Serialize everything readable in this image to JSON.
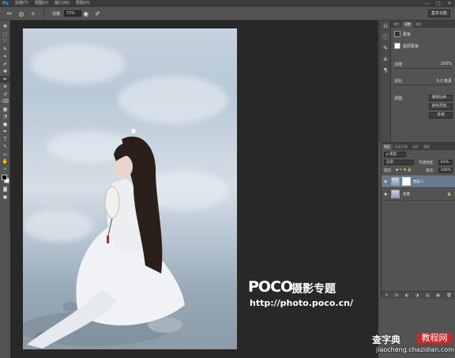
{
  "app": {
    "logo": "Ps"
  },
  "menubar": {
    "items": [
      "滤镜(T)",
      "视图(V)",
      "窗口(W)",
      "帮助(H)"
    ],
    "controls": [
      "—",
      "□",
      "✕"
    ]
  },
  "options": {
    "opacity_label": "流量:",
    "opacity_value": "72%",
    "workspace": "基本功能"
  },
  "tools": [
    "move-tool",
    "marquee-tool",
    "lasso-tool",
    "quick-select-tool",
    "crop-tool",
    "eyedropper-tool",
    "healing-tool",
    "brush-tool",
    "clone-stamp-tool",
    "history-brush-tool",
    "eraser-tool",
    "gradient-tool",
    "blur-tool",
    "dodge-tool",
    "pen-tool",
    "type-tool",
    "path-select-tool",
    "shape-tool",
    "hand-tool",
    "zoom-tool"
  ],
  "tool_glyphs": [
    "✥",
    "⬚",
    "➰",
    "✎",
    "⌗",
    "✐",
    "✚",
    "✏",
    "⎈",
    "↺",
    "⌫",
    "▦",
    "◔",
    "●",
    "✒",
    "T",
    "↖",
    "▭",
    "✋",
    "⌕"
  ],
  "properties": {
    "tabs": [
      "属性",
      "调整",
      "路径"
    ],
    "mask_title": "蒙板",
    "mask_type": "图层蒙板",
    "density_label": "浓度:",
    "density_value": "100%",
    "feather_label": "羽化:",
    "feather_value": "0.0 像素",
    "refine_label": "调整:",
    "buttons": [
      "蒙版边缘...",
      "颜色范围...",
      "反相"
    ]
  },
  "layers": {
    "tabs": [
      "图层",
      "历史记录",
      "动作",
      "通道"
    ],
    "filter_label": "ρ 类型",
    "blend_mode": "正常",
    "opacity_label": "不透明度:",
    "opacity_value": "61%",
    "lock_label": "锁定:",
    "fill_label": "填充:",
    "fill_value": "100%",
    "rows": [
      {
        "name": "图层 1",
        "selected": true,
        "has_mask": true
      },
      {
        "name": "背景",
        "selected": false,
        "has_mask": false
      }
    ],
    "footer_icons": [
      "⚭",
      "fx",
      "◐",
      "◑",
      "▤",
      "▣",
      "🗑"
    ]
  },
  "watermark": {
    "brand": "POCO",
    "title": "摄影专题",
    "url": "http://photo.poco.cn/"
  },
  "site_badge": {
    "name": "查字典",
    "tag": "教程网",
    "url": "jiaocheng.chazidian.com"
  },
  "colors": {
    "ui_dark": "#3a3a3a",
    "ui_mid": "#535353",
    "canvas_bg": "#282828",
    "accent_blue": "#31a8ff",
    "selected_layer": "#6a7a8e",
    "badge_red": "#c82828"
  }
}
